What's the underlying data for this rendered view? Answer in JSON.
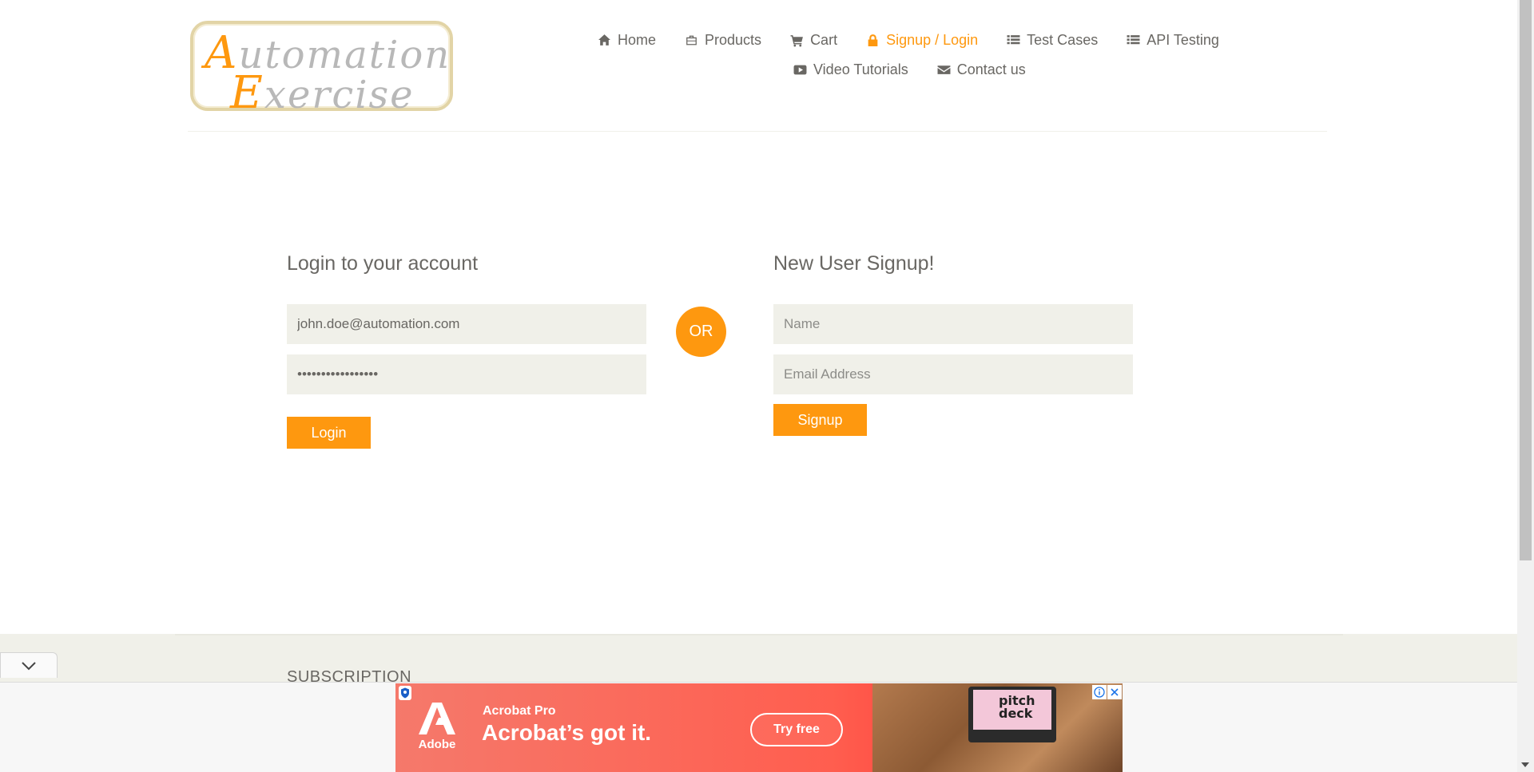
{
  "logo": {
    "line1_cap": "A",
    "line1_rest": "utomation",
    "line2_cap": "E",
    "line2_rest": "xercise"
  },
  "nav": {
    "row1": [
      {
        "label": "Home",
        "icon": "home-icon"
      },
      {
        "label": "Products",
        "icon": "briefcase-icon"
      },
      {
        "label": "Cart",
        "icon": "cart-icon"
      },
      {
        "label": "Signup / Login",
        "icon": "lock-icon",
        "active": true
      },
      {
        "label": "Test Cases",
        "icon": "list-icon"
      },
      {
        "label": "API Testing",
        "icon": "list-icon"
      }
    ],
    "row2": [
      {
        "label": "Video Tutorials",
        "icon": "youtube-play-icon"
      },
      {
        "label": "Contact us",
        "icon": "envelope-icon"
      }
    ]
  },
  "login": {
    "title": "Login to your account",
    "email_value": "john.doe@automation.com",
    "password_value": "•••••••••••••••••",
    "button_label": "Login"
  },
  "or_label": "OR",
  "signup": {
    "title": "New User Signup!",
    "name_placeholder": "Name",
    "email_placeholder": "Email Address",
    "button_label": "Signup"
  },
  "footer": {
    "subscription_title": "Subscription"
  },
  "ad": {
    "brand": "Adobe",
    "product": "Acrobat Pro",
    "headline": "Acrobat’s got it.",
    "cta": "Try free",
    "screen_text": "pitch deck"
  },
  "colors": {
    "accent": "#fe980f",
    "field_bg": "#f0f0e9",
    "text": "#696763"
  }
}
